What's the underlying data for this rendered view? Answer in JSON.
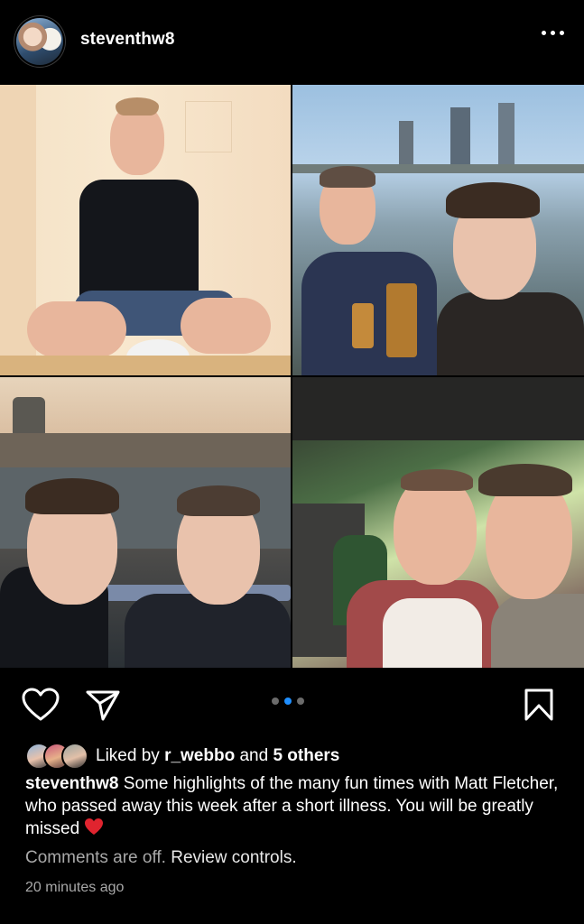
{
  "post": {
    "username": "steventhw8",
    "more_label": "More options"
  },
  "carousel": {
    "page_count": 3,
    "active_page": 2
  },
  "likes": {
    "prefix": "Liked by",
    "user": "r_webbo",
    "joiner": "and",
    "others": "5 others"
  },
  "caption": {
    "username": "steventhw8",
    "text": "Some highlights of the many fun times with Matt Fletcher, who passed away this week after a short illness. You will be greatly missed"
  },
  "comments": {
    "status": "Comments are off.",
    "link": "Review controls."
  },
  "timestamp": "20 minutes ago",
  "colors": {
    "background": "#000000",
    "text": "#ffffff",
    "muted": "#a8a8a8",
    "active_dot": "#1f8fff",
    "heart_emoji": "#e0242f"
  },
  "icons": [
    "more-icon",
    "like-heart-icon",
    "share-icon",
    "save-bookmark-icon",
    "red-heart-emoji"
  ]
}
